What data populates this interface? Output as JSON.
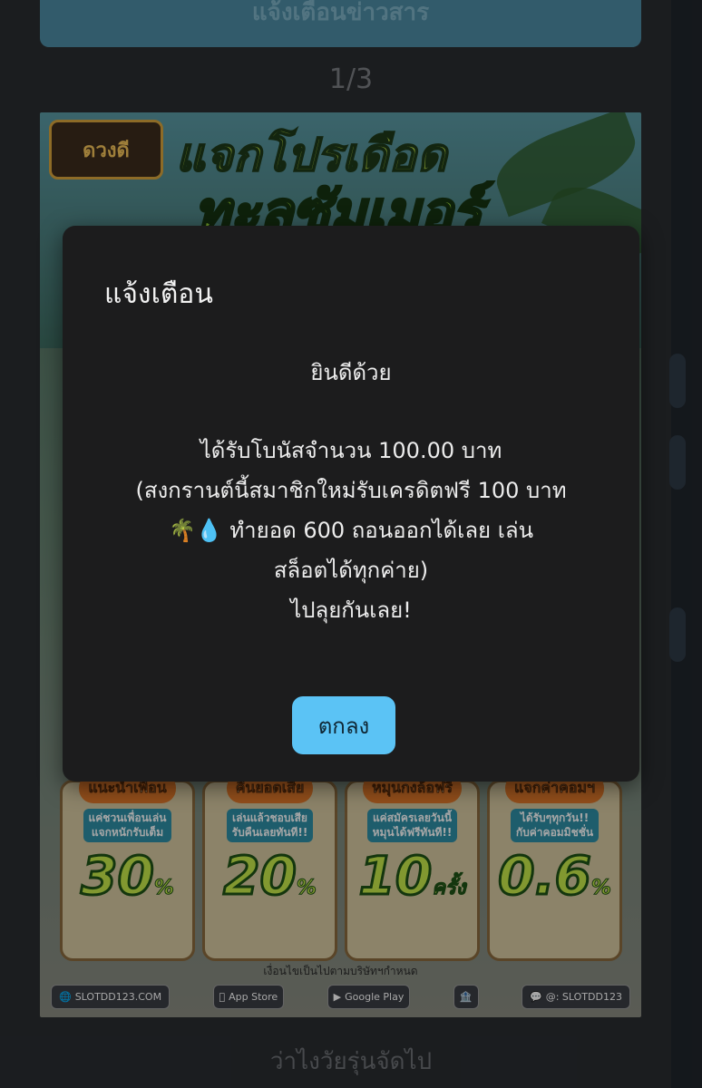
{
  "top_button": {
    "label": "แจ้งเตือนข่าวสาร"
  },
  "pager": {
    "text": "1/3"
  },
  "banner": {
    "logo_text": "ดวงดี",
    "title_line1": "แจกโปรเดือด",
    "title_line2": "ทะลซัมเมอร์",
    "cards": [
      {
        "head": "แนะนำเพื่อน",
        "sub1": "แค่ชวนเพื่อนเล่น",
        "sub2": "แจกหนักรับเต็ม",
        "big": "30",
        "unit": "%"
      },
      {
        "head": "คืนยอดเสีย",
        "sub1": "เล่นแล้วชอบเสีย",
        "sub2": "รับคืนเลยทันที!!",
        "big": "20",
        "unit": "%"
      },
      {
        "head": "หมุนกงล้อฟรี",
        "sub1": "แค่สมัครเลยวันนี้",
        "sub2": "หมุนได้ฟรีทันที!!",
        "big": "10",
        "unit": "ครั้ง"
      },
      {
        "head": "แจกค่าคอมฯ",
        "sub1": "ได้รับๆทุกวัน!!",
        "sub2": "กับค่าคอมมิชชั่น",
        "big": "0.6",
        "unit": "%"
      }
    ],
    "footer_note": "เงื่อนไขเป็นไปตามบริษัทฯกำหนด",
    "footer_items": {
      "site": "SLOTDD123.COM",
      "app_store": "App Store",
      "google_play": "Google Play",
      "line_id": "@: SLOTDD123"
    }
  },
  "bottom_text": "ว่าไงวัยรุ่นจัดไป",
  "modal": {
    "title": "แจ้งเตือน",
    "line1": "ยินดีด้วย",
    "line2": "ได้รับโบนัสจำนวน 100.00 บาท",
    "line3": "(สงกรานต์นี้สมาชิกใหม่รับเครดิตฟรี 100 บาท",
    "line4": "🌴💧 ทำยอด 600 ถอนออกได้เลย เล่น",
    "line5": "สล็อตได้ทุกค่าย)",
    "line6": "ไปลุยกันเลย!",
    "ok_label": "ตกลง"
  }
}
